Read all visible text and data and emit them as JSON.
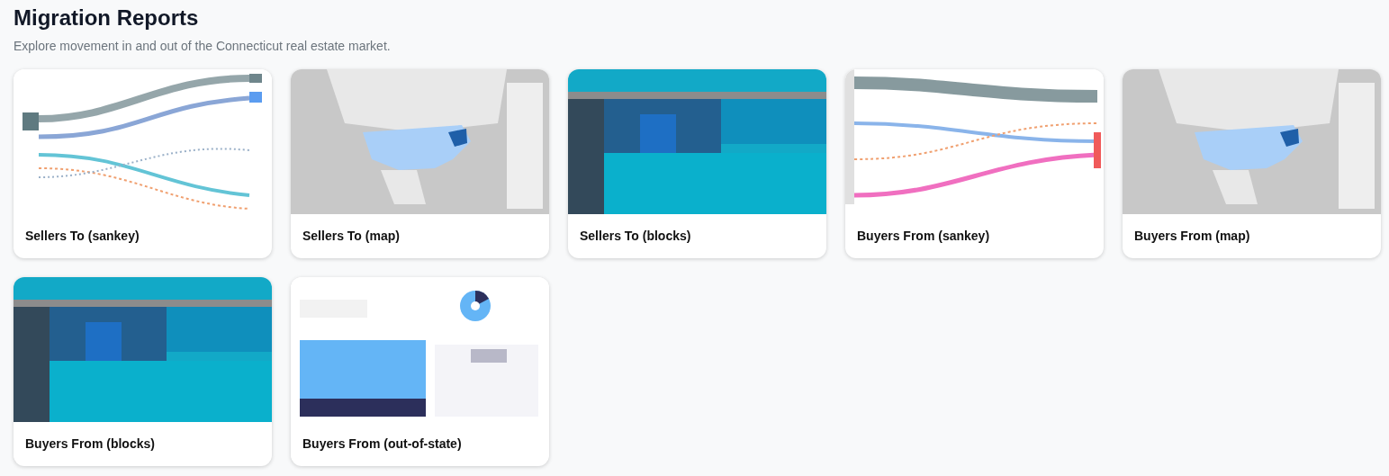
{
  "header": {
    "title": "Migration Reports",
    "subtitle": "Explore movement in and out of the Connecticut real estate market."
  },
  "reports": [
    {
      "title": "Sellers To (sankey)"
    },
    {
      "title": "Sellers To (map)"
    },
    {
      "title": "Sellers To (blocks)"
    },
    {
      "title": "Buyers From (sankey)"
    },
    {
      "title": "Buyers From (map)"
    },
    {
      "title": "Buyers From (blocks)"
    },
    {
      "title": "Buyers From (out-of-state)"
    }
  ]
}
